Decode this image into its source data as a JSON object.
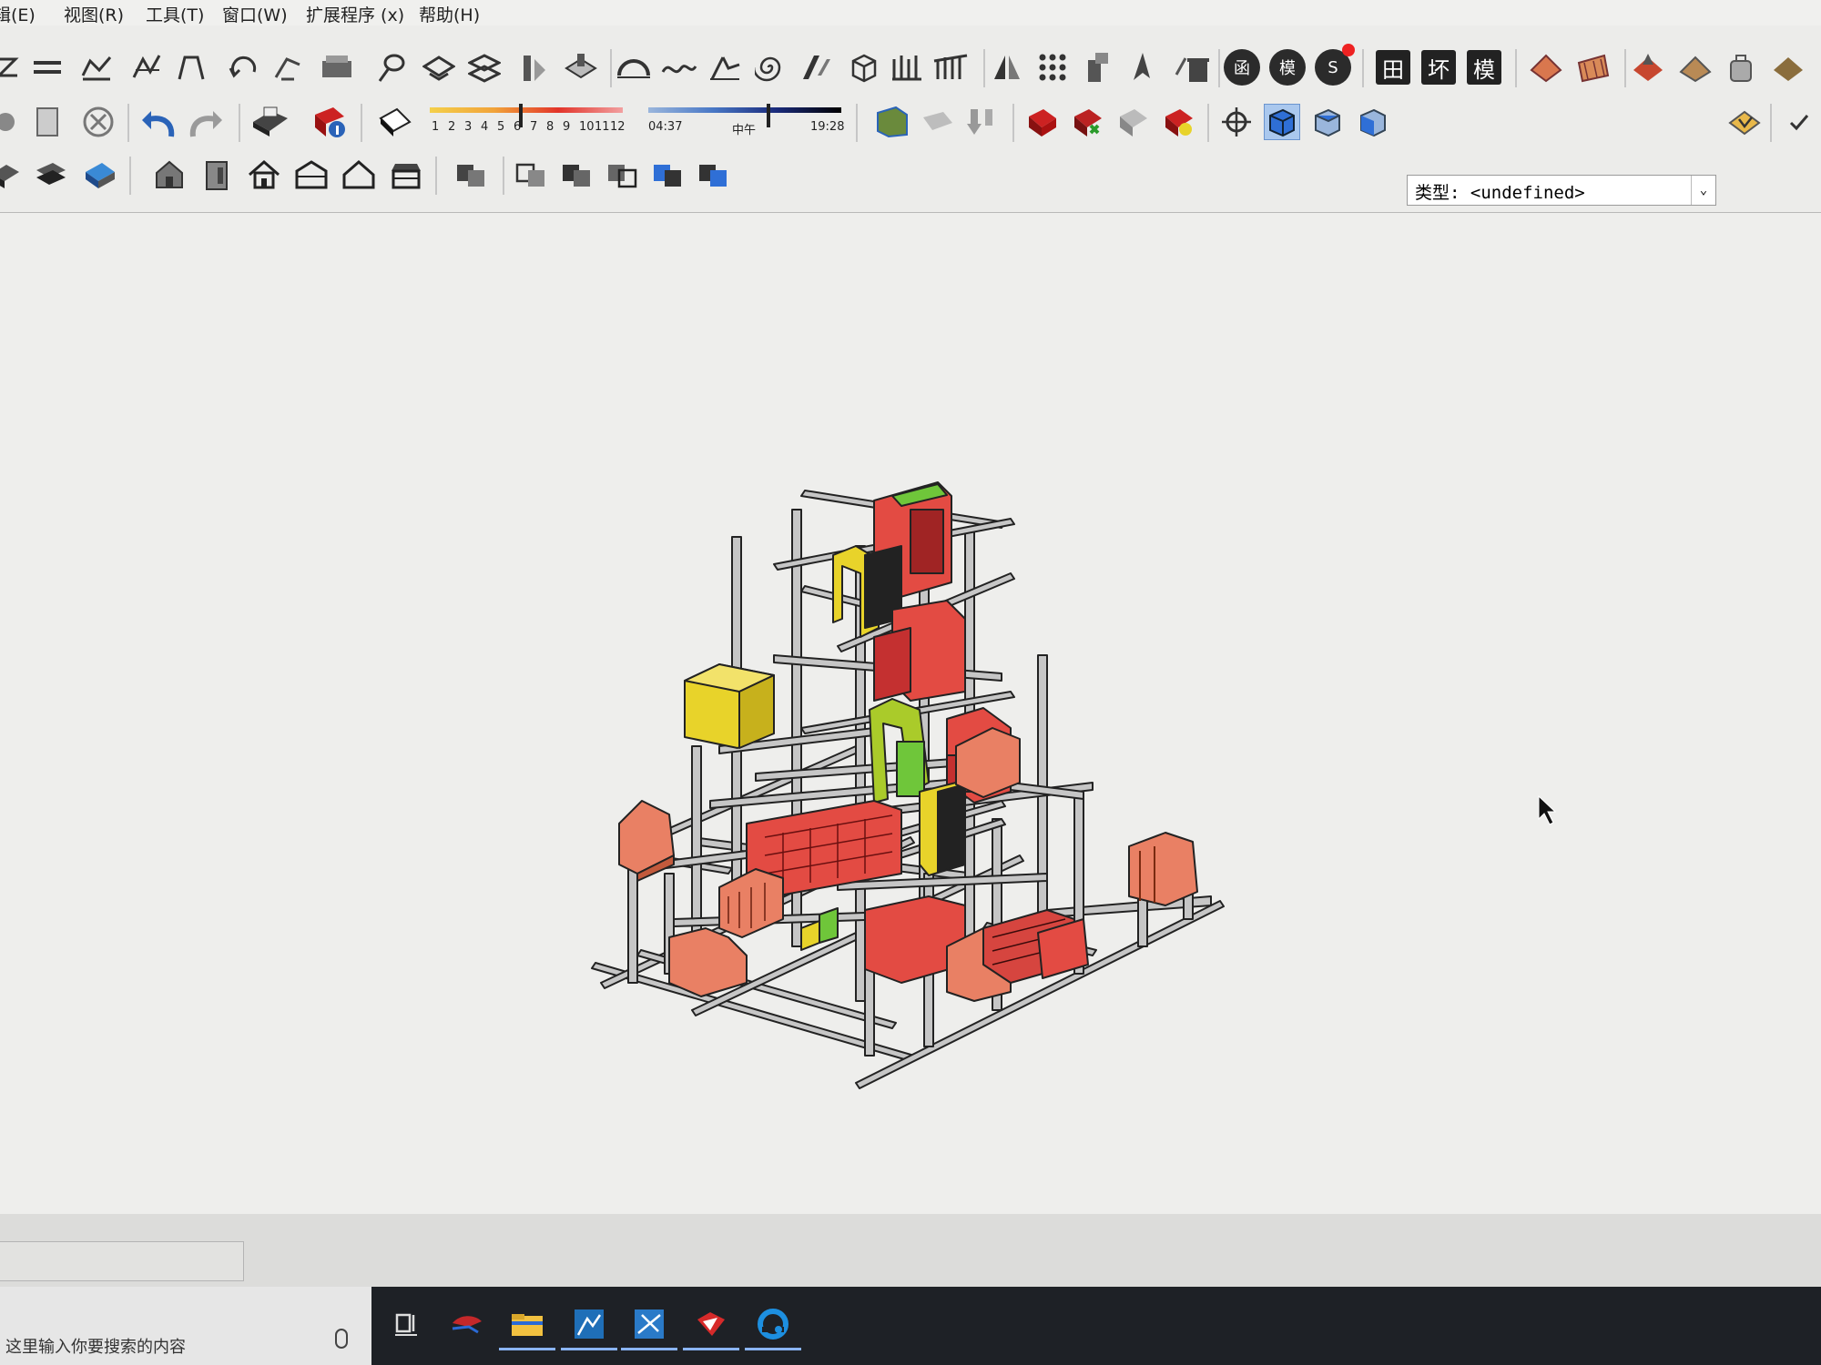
{
  "menubar": {
    "items": [
      "编辑(E)",
      "视图(R)",
      "工具(T)",
      "窗口(W)",
      "扩展程序 (x)",
      "帮助(H)"
    ]
  },
  "toolbar": {
    "month_scale": [
      "1",
      "2",
      "3",
      "4",
      "5",
      "6",
      "7",
      "8",
      "9",
      "10",
      "11",
      "12"
    ],
    "time_start": "04:37",
    "time_mid": "中午",
    "time_end": "19:28",
    "cjk_buttons": [
      "田",
      "坏",
      "模"
    ],
    "round_buttons": [
      "函",
      "模",
      "S"
    ],
    "type_label": "类型:",
    "type_value": "<undefined>"
  },
  "statusbar": {
    "field_value": ""
  },
  "taskbar": {
    "search_placeholder": "这里输入你要搜索的内容"
  },
  "colors": {
    "model_red": "#e34b43",
    "model_yellow": "#e8d32a",
    "model_green": "#6fc63a",
    "model_salmon": "#e98064",
    "frame_gray": "#c6c6c6",
    "accent_blue": "#2f6fd6"
  },
  "icons": {
    "row1": [
      "pan-icon",
      "lines-icon",
      "sandbox-icon",
      "sandbox-icon",
      "sandbox-icon",
      "rotate-icon",
      "smoove-icon",
      "stamp-icon",
      "drape-icon",
      "add-detail-icon",
      "flip-edge-icon",
      "dynamic-component-icon",
      "arc-icon",
      "follow-me-icon",
      "intersect-icon",
      "spiral-icon",
      "section-icon",
      "solid-icon",
      "pipe-icon",
      "railing-icon",
      "mirror-icon",
      "array-icon",
      "column-icon",
      "pen-icon",
      "trash-icon"
    ],
    "row2": [
      "back-icon",
      "page-icon",
      "cancel-icon",
      "undo-icon",
      "redo-icon",
      "print-icon",
      "model-info-icon",
      "shadow-icon",
      "photo-match-icon",
      "camera-icon",
      "import-icon",
      "3d-warehouse-icon",
      "share-model-icon",
      "extension-icon",
      "extension-warehouse-icon",
      "orbit-icon",
      "iso-view-icon",
      "top-view-icon",
      "front-view-icon",
      "component-options-icon",
      "check-icon"
    ],
    "row3": [
      "layer-icon",
      "layer-icon",
      "layer-icon",
      "house-icon",
      "door-icon",
      "home-icon",
      "roof-icon",
      "home-outline-icon",
      "garage-icon",
      "group-icon",
      "solid-union-icon",
      "solid-subtract-icon",
      "solid-trim-icon",
      "solid-split-icon",
      "solid-outer-icon"
    ]
  }
}
